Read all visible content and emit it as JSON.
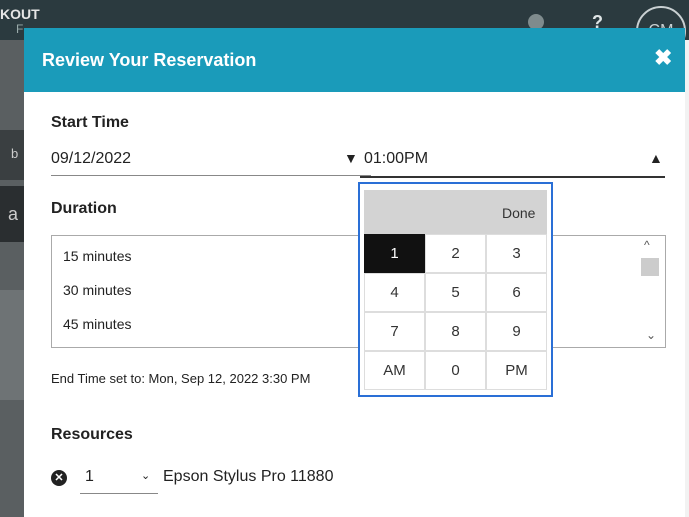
{
  "background": {
    "logo": "KOUT",
    "sub": "F",
    "help": "?",
    "avatar": "CM",
    "left_letters": [
      "b",
      "a"
    ]
  },
  "modal": {
    "title": "Review Your Reservation",
    "close_glyph": "✖"
  },
  "start_time": {
    "label": "Start Time",
    "date_value": "09/12/2022",
    "date_arrow": "▼",
    "time_value": "01:00PM",
    "time_arrow": "▲"
  },
  "duration": {
    "label": "Duration",
    "options": [
      "15 minutes",
      "30 minutes",
      "45 minutes"
    ],
    "scroll_up": "^",
    "scroll_down": "⌄"
  },
  "end_time": "End Time set to: Mon, Sep 12, 2022 3:30 PM",
  "resources": {
    "label": "Resources",
    "remove_glyph": "✕",
    "quantity": "1",
    "quantity_chevron": "⌄",
    "name": "Epson Stylus Pro 11880"
  },
  "picker": {
    "done_label": "Done",
    "keys": [
      [
        "1",
        "2",
        "3"
      ],
      [
        "4",
        "5",
        "6"
      ],
      [
        "7",
        "8",
        "9"
      ],
      [
        "AM",
        "0",
        "PM"
      ]
    ],
    "selected_key": "1"
  },
  "colors": {
    "header": "#1a9bba",
    "picker_border": "#2a6fd6",
    "selected_key": "#111111"
  }
}
